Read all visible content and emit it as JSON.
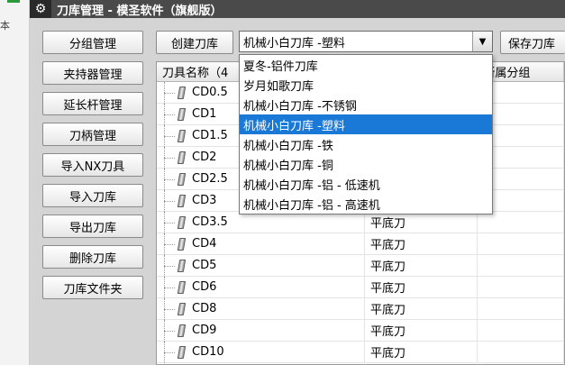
{
  "left_edge": {
    "hint": "本"
  },
  "window": {
    "title": "刀库管理 - 模圣软件（旗舰版）"
  },
  "sidebar": {
    "items": [
      {
        "label": "分组管理"
      },
      {
        "label": "夹持器管理"
      },
      {
        "label": "延长杆管理"
      },
      {
        "label": "刀柄管理"
      },
      {
        "label": "导入NX刀具"
      },
      {
        "label": "导入刀库"
      },
      {
        "label": "导出刀库"
      },
      {
        "label": "删除刀库"
      },
      {
        "label": "刀库文件夹"
      }
    ]
  },
  "toolbar": {
    "create_label": "创建刀库",
    "save_label": "保存刀库",
    "selected_library": "机械小白刀库 -塑料"
  },
  "dropdown": {
    "options": [
      {
        "label": "夏冬-铝件刀库"
      },
      {
        "label": "岁月如歌刀库"
      },
      {
        "label": "机械小白刀库 -不锈钢"
      },
      {
        "label": "机械小白刀库 -塑料"
      },
      {
        "label": "机械小白刀库 -铁"
      },
      {
        "label": "机械小白刀库 -铜"
      },
      {
        "label": "机械小白刀库 -铝 - 低速机"
      },
      {
        "label": "机械小白刀库 -铝 - 高速机"
      }
    ],
    "selected_index": 3
  },
  "table": {
    "headers": {
      "name": "刀具名称（4",
      "type": "",
      "group": "所属分组"
    },
    "rows": [
      {
        "name": "CD0.5",
        "type": ""
      },
      {
        "name": "CD1",
        "type": ""
      },
      {
        "name": "CD1.5",
        "type": ""
      },
      {
        "name": "CD2",
        "type": ""
      },
      {
        "name": "CD2.5",
        "type": ""
      },
      {
        "name": "CD3",
        "type": ""
      },
      {
        "name": "CD3.5",
        "type": "平底刀"
      },
      {
        "name": "CD4",
        "type": "平底刀"
      },
      {
        "name": "CD5",
        "type": "平底刀"
      },
      {
        "name": "CD6",
        "type": "平底刀"
      },
      {
        "name": "CD8",
        "type": "平底刀"
      },
      {
        "name": "CD9",
        "type": "平底刀"
      },
      {
        "name": "CD10",
        "type": "平底刀"
      }
    ]
  },
  "colors": {
    "titlebar": "#4a4a4a",
    "selection": "#1a78d7",
    "window_bg": "#d4d4d4"
  }
}
